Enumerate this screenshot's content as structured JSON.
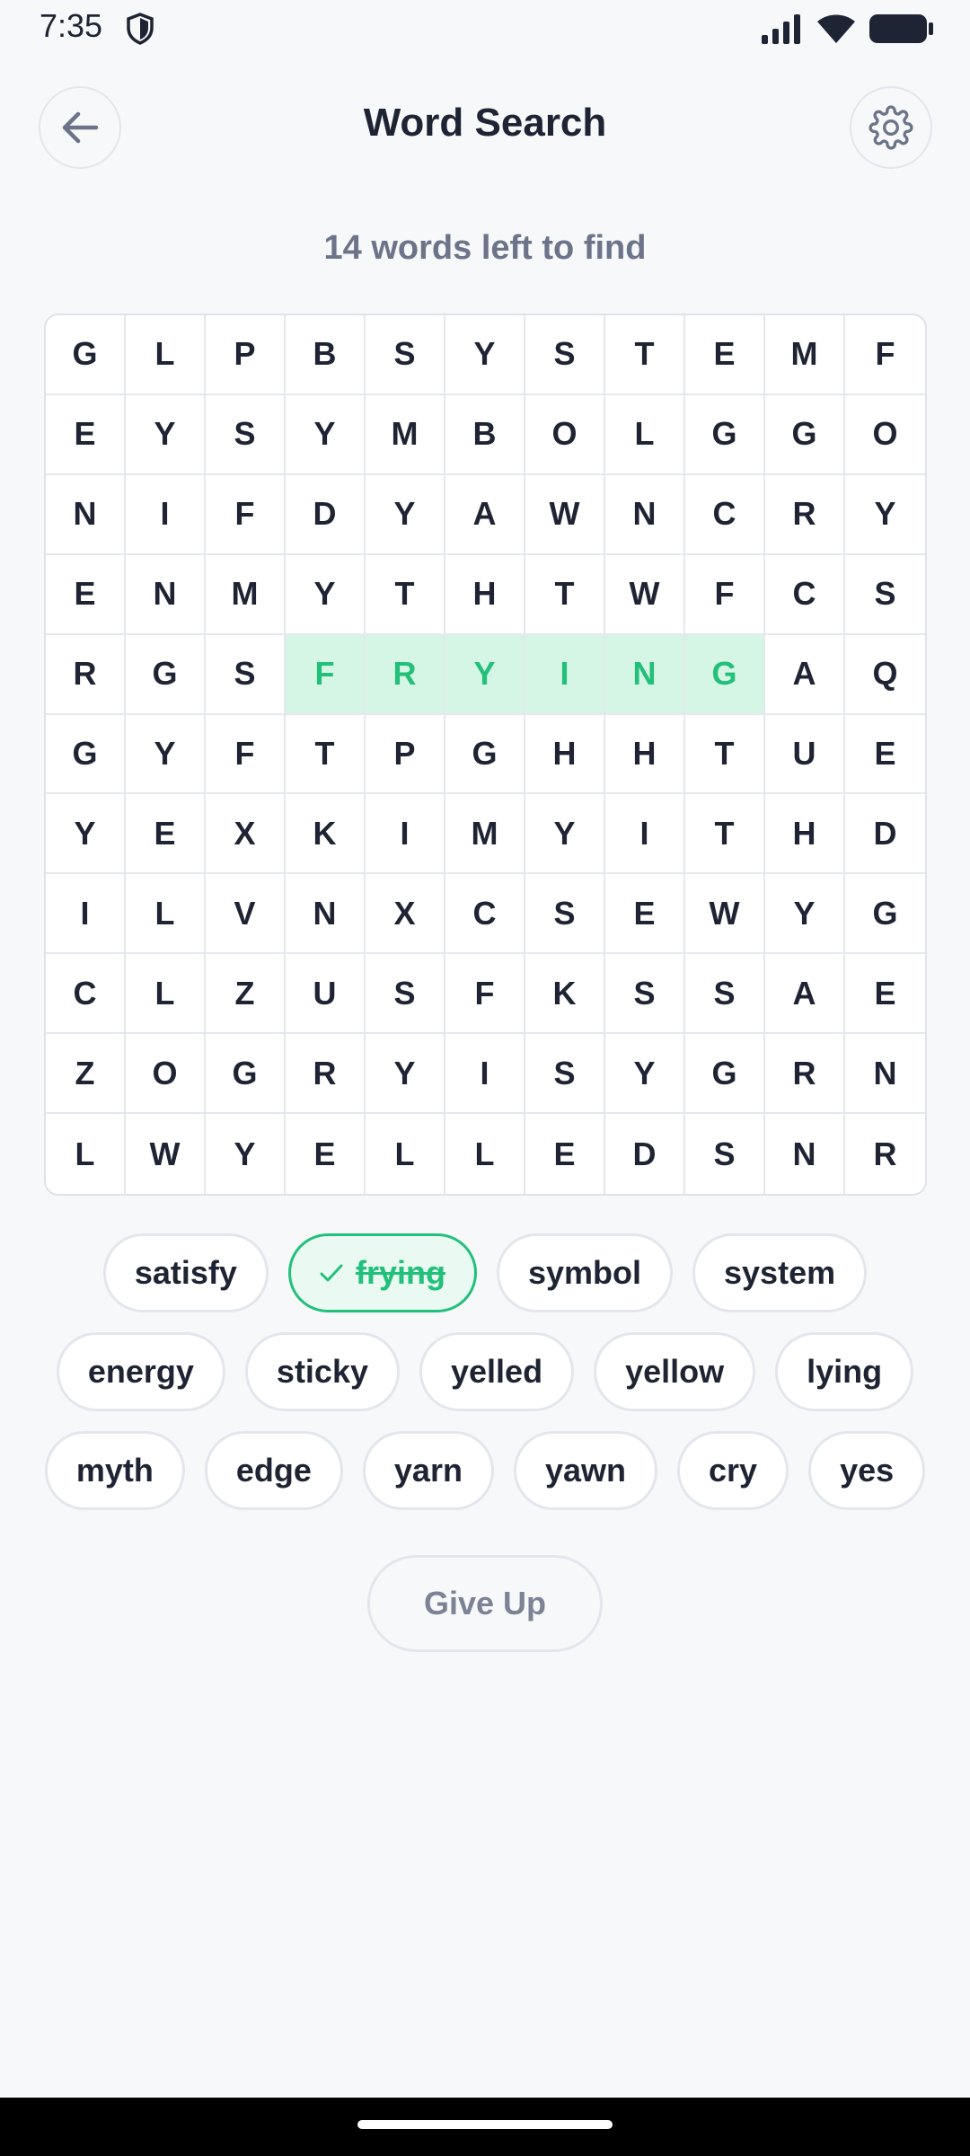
{
  "status_bar": {
    "time": "7:35"
  },
  "header": {
    "title": "Word Search"
  },
  "progress_text": "14 words left to find",
  "grid": [
    [
      "G",
      "L",
      "P",
      "B",
      "S",
      "Y",
      "S",
      "T",
      "E",
      "M",
      "F"
    ],
    [
      "E",
      "Y",
      "S",
      "Y",
      "M",
      "B",
      "O",
      "L",
      "G",
      "G",
      "O"
    ],
    [
      "N",
      "I",
      "F",
      "D",
      "Y",
      "A",
      "W",
      "N",
      "C",
      "R",
      "Y"
    ],
    [
      "E",
      "N",
      "M",
      "Y",
      "T",
      "H",
      "T",
      "W",
      "F",
      "C",
      "S"
    ],
    [
      "R",
      "G",
      "S",
      "F",
      "R",
      "Y",
      "I",
      "N",
      "G",
      "A",
      "Q"
    ],
    [
      "G",
      "Y",
      "F",
      "T",
      "P",
      "G",
      "H",
      "H",
      "T",
      "U",
      "E"
    ],
    [
      "Y",
      "E",
      "X",
      "K",
      "I",
      "M",
      "Y",
      "I",
      "T",
      "H",
      "D"
    ],
    [
      "I",
      "L",
      "V",
      "N",
      "X",
      "C",
      "S",
      "E",
      "W",
      "Y",
      "G"
    ],
    [
      "C",
      "L",
      "Z",
      "U",
      "S",
      "F",
      "K",
      "S",
      "S",
      "A",
      "E"
    ],
    [
      "Z",
      "O",
      "G",
      "R",
      "Y",
      "I",
      "S",
      "Y",
      "G",
      "R",
      "N"
    ],
    [
      "L",
      "W",
      "Y",
      "E",
      "L",
      "L",
      "E",
      "D",
      "S",
      "N",
      "R"
    ]
  ],
  "found_cells": [
    [
      4,
      3
    ],
    [
      4,
      4
    ],
    [
      4,
      5
    ],
    [
      4,
      6
    ],
    [
      4,
      7
    ],
    [
      4,
      8
    ]
  ],
  "word_rows": [
    [
      {
        "word": "satisfy",
        "found": false
      },
      {
        "word": "frying",
        "found": true
      },
      {
        "word": "symbol",
        "found": false
      },
      {
        "word": "system",
        "found": false
      }
    ],
    [
      {
        "word": "energy",
        "found": false
      },
      {
        "word": "sticky",
        "found": false
      },
      {
        "word": "yelled",
        "found": false
      },
      {
        "word": "yellow",
        "found": false
      },
      {
        "word": "lying",
        "found": false
      }
    ],
    [
      {
        "word": "myth",
        "found": false
      },
      {
        "word": "edge",
        "found": false
      },
      {
        "word": "yarn",
        "found": false
      },
      {
        "word": "yawn",
        "found": false
      },
      {
        "word": "cry",
        "found": false
      },
      {
        "word": "yes",
        "found": false
      }
    ]
  ],
  "give_up_label": "Give Up",
  "colors": {
    "accent": "#22c07a",
    "found_bg": "#d5f5e5",
    "text": "#1e2433",
    "muted": "#6b7488"
  }
}
